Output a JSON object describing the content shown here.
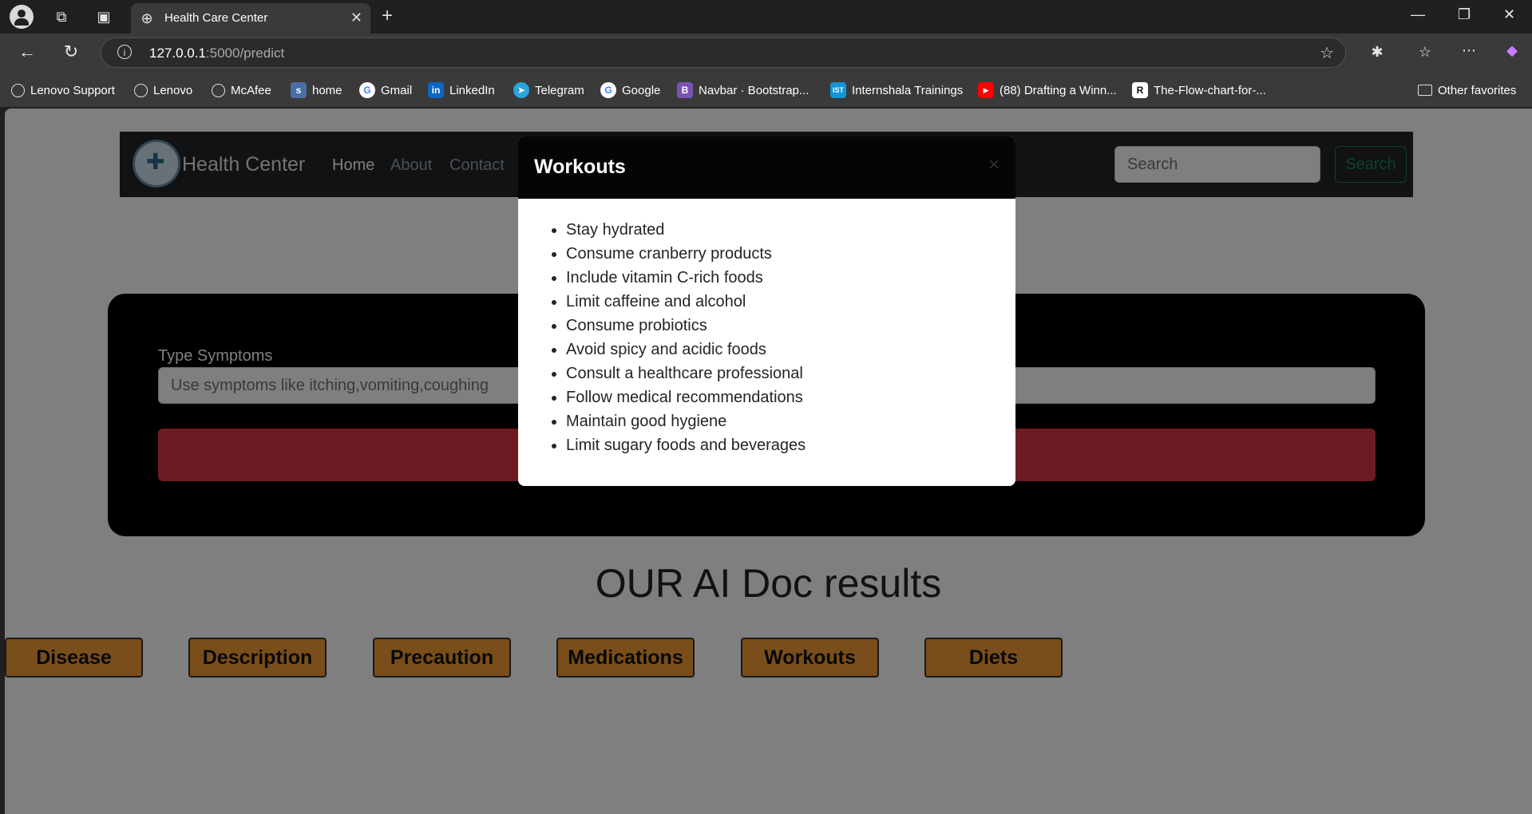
{
  "browser": {
    "tab_title": "Health Care Center",
    "url_host": "127.0.0.1",
    "url_path": ":5000/predict",
    "bookmarks": [
      {
        "label": "Lenovo Support",
        "icon": "globe-icon"
      },
      {
        "label": "Lenovo",
        "icon": "globe-icon"
      },
      {
        "label": "McAfee",
        "icon": "globe-icon"
      },
      {
        "label": "home",
        "icon": "home-favicon"
      },
      {
        "label": "Gmail",
        "icon": "google-icon"
      },
      {
        "label": "LinkedIn",
        "icon": "linkedin-icon"
      },
      {
        "label": "Telegram",
        "icon": "telegram-icon"
      },
      {
        "label": "Google",
        "icon": "google-icon"
      },
      {
        "label": "Navbar · Bootstrap...",
        "icon": "bootstrap-icon"
      },
      {
        "label": "Internshala Trainings",
        "icon": "internshala-icon"
      },
      {
        "label": "(88) Drafting a Winn...",
        "icon": "youtube-icon"
      },
      {
        "label": "The-Flow-chart-for-...",
        "icon": "r-icon"
      }
    ],
    "other_favorites": "Other favorites"
  },
  "site": {
    "brand": "Health Center",
    "nav": [
      "Home",
      "About",
      "Contact"
    ],
    "search_placeholder": "Search",
    "search_button": "Search",
    "form_label": "Type Symptoms",
    "form_placeholder": "Use symptoms like itching,vomiting,coughing",
    "results_title": "OUR AI Doc results",
    "result_buttons": [
      "Disease",
      "Description",
      "Precaution",
      "Medications",
      "Workouts",
      "Diets"
    ]
  },
  "modal": {
    "title": "Workouts",
    "close": "×",
    "items": [
      "Stay hydrated",
      "Consume cranberry products",
      "Include vitamin C-rich foods",
      "Limit caffeine and alcohol",
      "Consume probiotics",
      "Avoid spicy and acidic foods",
      "Consult a healthcare professional",
      "Follow medical recommendations",
      "Maintain good hygiene",
      "Limit sugary foods and beverages"
    ]
  },
  "colors": {
    "accent_button": "#f39c36",
    "submit_red": "#dc3545",
    "search_green": "#198754"
  }
}
